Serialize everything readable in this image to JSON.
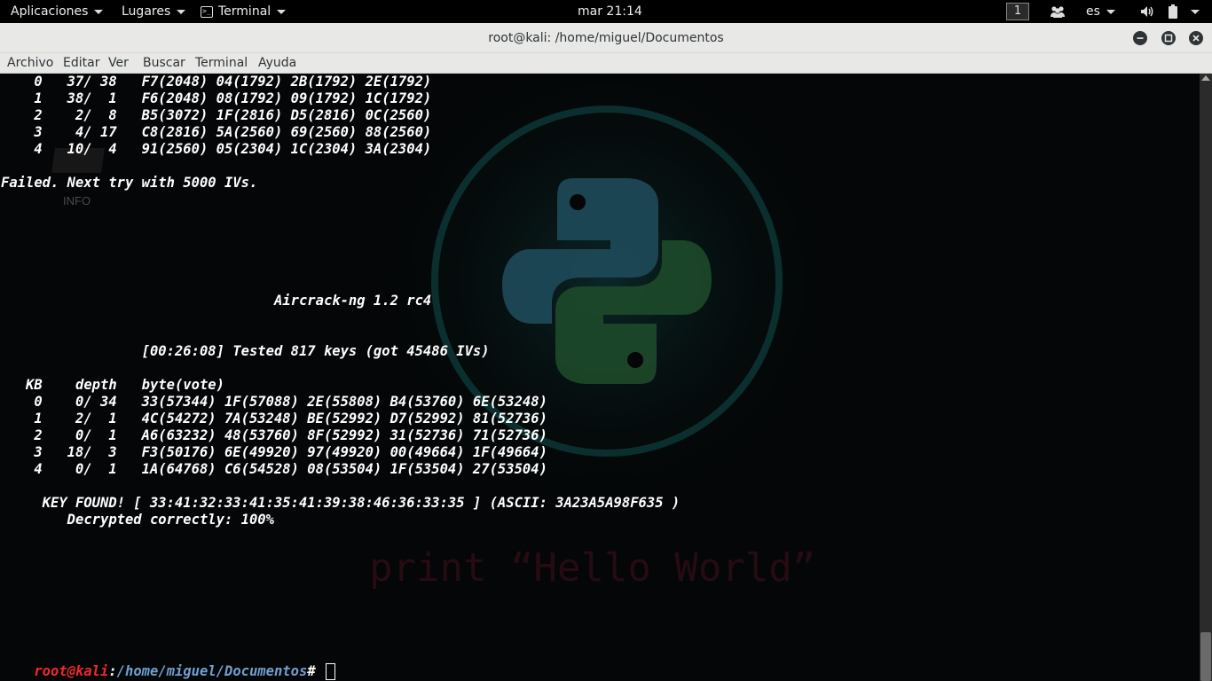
{
  "topbar": {
    "applications": "Aplicaciones",
    "places": "Lugares",
    "app_menu": "Terminal",
    "clock": "mar 21:14",
    "workspace": "1",
    "keyboard_layout": "es"
  },
  "window": {
    "title": "root@kali: /home/miguel/Documentos"
  },
  "menubar": {
    "items": [
      "Archivo",
      "Editar",
      "Ver",
      "Buscar",
      "Terminal",
      "Ayuda"
    ]
  },
  "desktop": {
    "info_label": "INFO"
  },
  "terminal": {
    "lines": [
      "    0   37/ 38   F7(2048) 04(1792) 2B(1792) 2E(1792)",
      "    1   38/  1   F6(2048) 08(1792) 09(1792) 1C(1792)",
      "    2    2/  8   B5(3072) 1F(2816) D5(2816) 0C(2560)",
      "    3    4/ 17   C8(2816) 5A(2560) 69(2560) 88(2560)",
      "    4   10/  4   91(2560) 05(2304) 1C(2304) 3A(2304)",
      "",
      "Failed. Next try with 5000 IVs.",
      "",
      "",
      "",
      "",
      "",
      "",
      "                                 Aircrack-ng 1.2 rc4",
      "",
      "",
      "                 [00:26:08] Tested 817 keys (got 45486 IVs)",
      "",
      "   KB    depth   byte(vote)",
      "    0    0/ 34   33(57344) 1F(57088) 2E(55808) B4(53760) 6E(53248)",
      "    1    2/  1   4C(54272) 7A(53248) BE(52992) D7(52992) 81(52736)",
      "    2    0/  1   A6(63232) 48(53760) 8F(52992) 31(52736) 71(52736)",
      "    3   18/  3   F3(50176) 6E(49920) 97(49920) 00(49664) 1F(49664)",
      "    4    0/  1   1A(64768) C6(54528) 08(53504) 1F(53504) 27(53504)",
      "",
      "     KEY FOUND! [ 33:41:32:33:41:35:41:39:38:46:36:33:35 ] (ASCII: 3A23A5A98F635 )",
      "        Decrypted correctly: 100%",
      "",
      ""
    ],
    "prompt": {
      "user_host": "root@kali",
      "sep": ":",
      "path": "/home/miguel/Documentos",
      "symbol": "# "
    }
  },
  "wallpaper": {
    "text": "print “Hello World”"
  }
}
